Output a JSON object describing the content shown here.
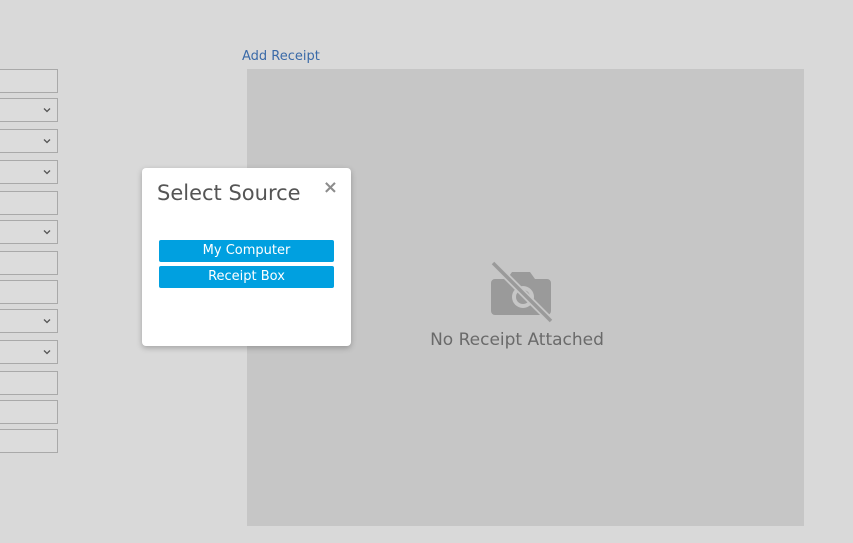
{
  "add_receipt_link": "Add Receipt",
  "receipt_panel": {
    "empty_text": "No Receipt Attached",
    "icon": "camera-off-icon"
  },
  "modal": {
    "title": "Select Source",
    "close_label": "×",
    "buttons": [
      {
        "label": "My Computer"
      },
      {
        "label": "Receipt Box"
      }
    ]
  },
  "form_fields": [
    {
      "type": "text"
    },
    {
      "type": "select"
    },
    {
      "type": "select"
    },
    {
      "type": "select"
    },
    {
      "type": "text"
    },
    {
      "type": "select"
    },
    {
      "type": "text"
    },
    {
      "type": "text"
    },
    {
      "type": "select"
    },
    {
      "type": "select"
    },
    {
      "type": "text"
    },
    {
      "type": "text"
    },
    {
      "type": "text"
    }
  ],
  "colors": {
    "background": "#d9d9d9",
    "panel": "#c6c6c6",
    "button": "#00a0e0",
    "link": "#3a6aa8"
  }
}
